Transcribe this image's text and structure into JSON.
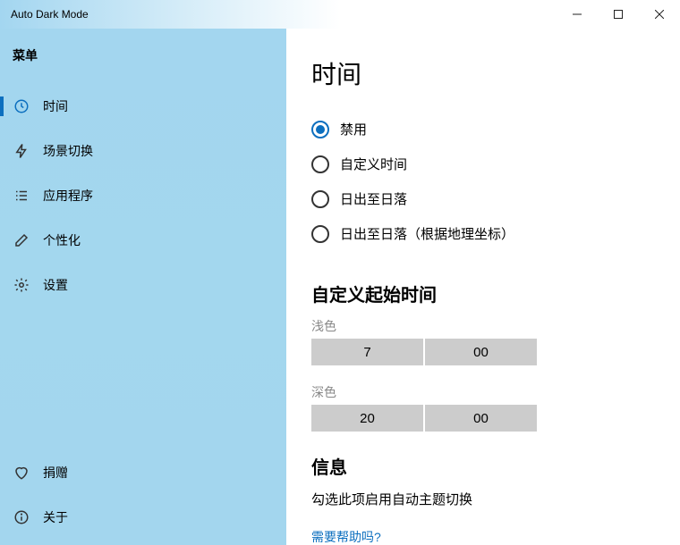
{
  "titlebar": {
    "title": "Auto Dark Mode"
  },
  "sidebar": {
    "header": "菜单",
    "items": [
      {
        "id": "time",
        "label": "时间"
      },
      {
        "id": "scene",
        "label": "场景切换"
      },
      {
        "id": "apps",
        "label": "应用程序"
      },
      {
        "id": "personalize",
        "label": "个性化"
      },
      {
        "id": "settings",
        "label": "设置"
      }
    ],
    "footer": [
      {
        "id": "donate",
        "label": "捐赠"
      },
      {
        "id": "about",
        "label": "关于"
      }
    ]
  },
  "main": {
    "heading": "时间",
    "radios": [
      {
        "label": "禁用",
        "selected": true
      },
      {
        "label": "自定义时间",
        "selected": false
      },
      {
        "label": "日出至日落",
        "selected": false
      },
      {
        "label": "日出至日落（根据地理坐标）",
        "selected": false
      }
    ],
    "customSection": {
      "heading": "自定义起始时间",
      "light": {
        "label": "浅色",
        "hour": "7",
        "minute": "00"
      },
      "dark": {
        "label": "深色",
        "hour": "20",
        "minute": "00"
      }
    },
    "infoSection": {
      "heading": "信息",
      "text": "勾选此项启用自动主题切换",
      "helpLink": "需要帮助吗?"
    }
  }
}
